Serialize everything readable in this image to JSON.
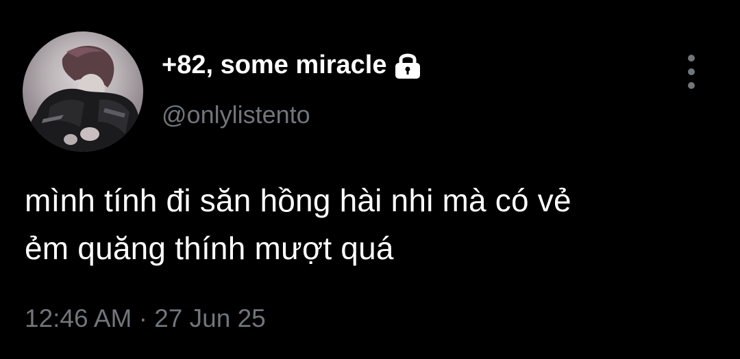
{
  "tweet": {
    "author": {
      "display_name": "+82, some miracle",
      "handle": "@onlylistento",
      "protected_icon": "lock-icon",
      "avatar_icon": "avatar-photo"
    },
    "more_icon": "more-vertical-icon",
    "text": "mình tính đi săn hồng hài nhi mà có vẻ\nẻm quăng thính mượt quá",
    "time": "12:46 AM",
    "separator": "·",
    "date": "27 Jun 25"
  },
  "colors": {
    "background": "#000000",
    "primary_text": "#ffffff",
    "secondary_text": "#71767b"
  }
}
